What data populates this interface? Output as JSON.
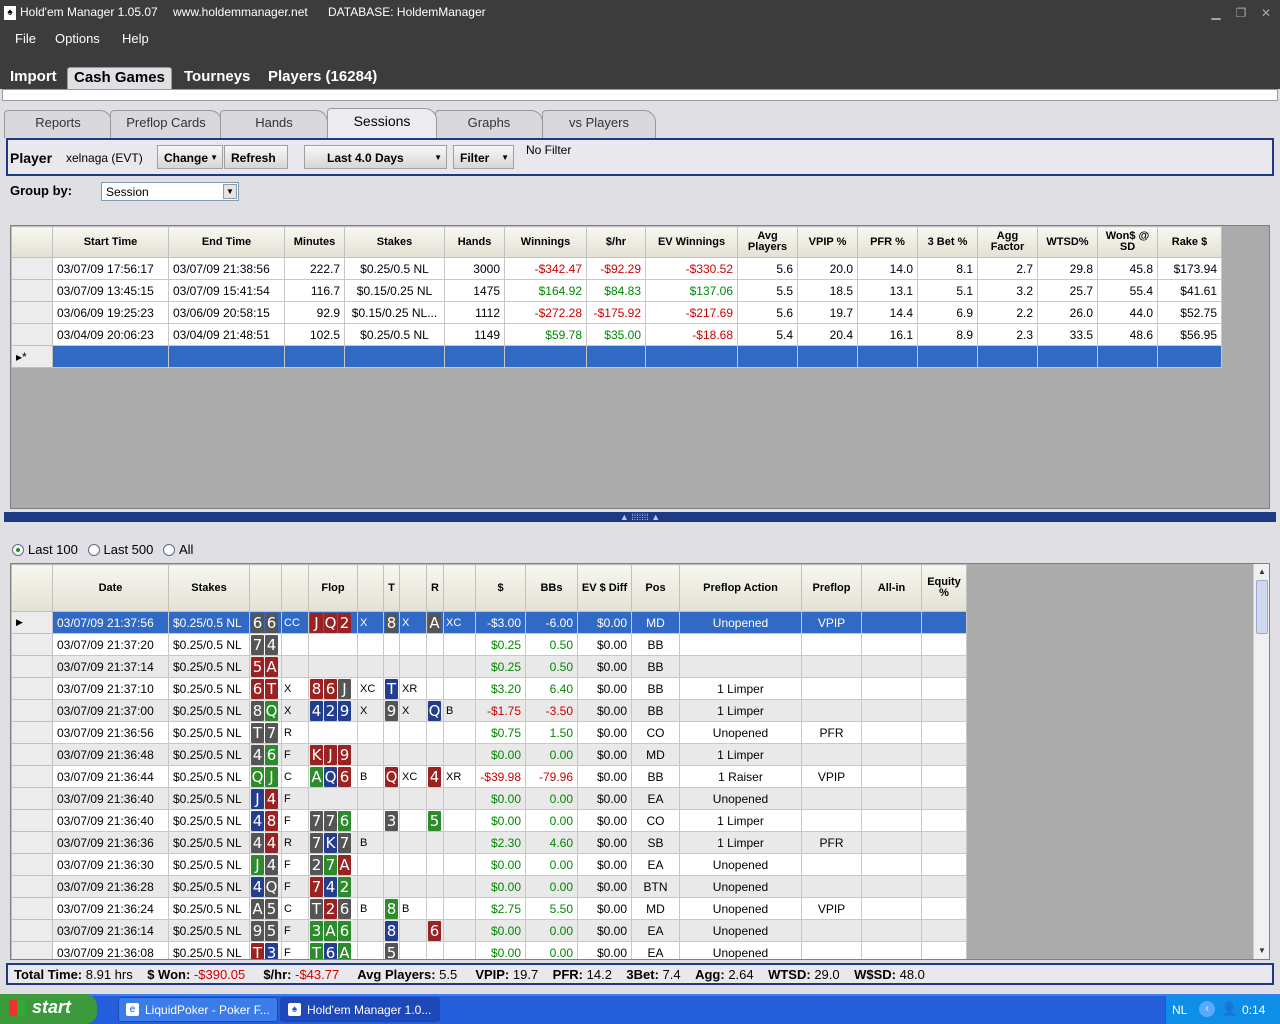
{
  "window": {
    "app_title": "Hold'em Manager 1.05.07",
    "site": "www.holdemmanager.net",
    "database": "DATABASE: HoldemManager"
  },
  "menu": {
    "file": "File",
    "options": "Options",
    "help": "Help"
  },
  "main_tabs": [
    "Import",
    "Cash Games",
    "Tourneys",
    "Players (16284)"
  ],
  "sub_tabs": [
    "Reports",
    "Preflop Cards",
    "Hands",
    "Sessions",
    "Graphs",
    "vs Players"
  ],
  "player_bar": {
    "player_label": "Player",
    "player_name": "xelnaga (EVT)",
    "change": "Change",
    "refresh": "Refresh",
    "date_range": "Last 4.0 Days",
    "filter": "Filter",
    "filter_status": "No Filter"
  },
  "group_by": {
    "label": "Group by:",
    "value": "Session"
  },
  "sessions": {
    "headers": [
      "Start Time",
      "End Time",
      "Minutes",
      "Stakes",
      "Hands",
      "Winnings",
      "$/hr",
      "EV Winnings",
      "Avg Players",
      "VPIP %",
      "PFR %",
      "3 Bet %",
      "Agg Factor",
      "WTSD%",
      "Won$ @ SD",
      "Rake $"
    ],
    "rows": [
      [
        "03/07/09 17:56:17",
        "03/07/09 21:38:56",
        "222.7",
        "$0.25/0.5 NL",
        "3000",
        "-$342.47",
        "-$92.29",
        "-$330.52",
        "5.6",
        "20.0",
        "14.0",
        "8.1",
        "2.7",
        "29.8",
        "45.8",
        "$173.94"
      ],
      [
        "03/07/09 13:45:15",
        "03/07/09 15:41:54",
        "116.7",
        "$0.15/0.25 NL",
        "1475",
        "$164.92",
        "$84.83",
        "$137.06",
        "5.5",
        "18.5",
        "13.1",
        "5.1",
        "3.2",
        "25.7",
        "55.4",
        "$41.61"
      ],
      [
        "03/06/09 19:25:23",
        "03/06/09 20:58:15",
        "92.9",
        "$0.15/0.25 NL...",
        "1112",
        "-$272.28",
        "-$175.92",
        "-$217.69",
        "5.6",
        "19.7",
        "14.4",
        "6.9",
        "2.2",
        "26.0",
        "44.0",
        "$52.75"
      ],
      [
        "03/04/09 20:06:23",
        "03/04/09 21:48:51",
        "102.5",
        "$0.25/0.5 NL",
        "1149",
        "$59.78",
        "$35.00",
        "-$18.68",
        "5.4",
        "20.4",
        "16.1",
        "8.9",
        "2.3",
        "33.5",
        "48.6",
        "$56.95"
      ]
    ],
    "new_row_marker": "▸*"
  },
  "hands_filter": {
    "last100": "Last 100",
    "last500": "Last 500",
    "all": "All",
    "selected": "last100"
  },
  "hands": {
    "headers": [
      "Date",
      "Stakes",
      "",
      "",
      "Flop",
      "",
      "T",
      "",
      "R",
      "",
      "$",
      "BBs",
      "EV $ Diff",
      "Pos",
      "Preflop Action",
      "Preflop",
      "All-in",
      "Equity %"
    ],
    "rows": [
      {
        "date": "03/07/09 21:37:56",
        "stakes": "$0.25/0.5 NL",
        "hole": [
          "6s",
          "6s"
        ],
        "pa": "CC",
        "flop": [
          "Jh",
          "Qh",
          "2h"
        ],
        "fa": "X",
        "turn": [
          "8s"
        ],
        "ta": "X",
        "river": [
          "As"
        ],
        "ra": "XC",
        "won": "-$3.00",
        "bbs": "-6.00",
        "ev": "$0.00",
        "pos": "MD",
        "action": "Unopened",
        "preflop": "VPIP"
      },
      {
        "date": "03/07/09 21:37:20",
        "stakes": "$0.25/0.5 NL",
        "hole": [
          "7s",
          "4s"
        ],
        "pa": "",
        "flop": [],
        "fa": "",
        "turn": [],
        "ta": "",
        "river": [],
        "ra": "",
        "won": "$0.25",
        "bbs": "0.50",
        "ev": "$0.00",
        "pos": "BB",
        "action": "",
        "preflop": ""
      },
      {
        "date": "03/07/09 21:37:14",
        "stakes": "$0.25/0.5 NL",
        "hole": [
          "5h",
          "Ah"
        ],
        "pa": "",
        "flop": [],
        "fa": "",
        "turn": [],
        "ta": "",
        "river": [],
        "ra": "",
        "won": "$0.25",
        "bbs": "0.50",
        "ev": "$0.00",
        "pos": "BB",
        "action": "",
        "preflop": ""
      },
      {
        "date": "03/07/09 21:37:10",
        "stakes": "$0.25/0.5 NL",
        "hole": [
          "6h",
          "Th"
        ],
        "pa": "X",
        "flop": [
          "8h",
          "6h",
          "Js"
        ],
        "fa": "XC",
        "turn": [
          "Td"
        ],
        "ta": "XR",
        "river": [],
        "ra": "",
        "won": "$3.20",
        "bbs": "6.40",
        "ev": "$0.00",
        "pos": "BB",
        "action": "1 Limper",
        "preflop": ""
      },
      {
        "date": "03/07/09 21:37:00",
        "stakes": "$0.25/0.5 NL",
        "hole": [
          "8s",
          "Qk"
        ],
        "pa": "X",
        "flop": [
          "4d",
          "2d",
          "9d"
        ],
        "fa": "X",
        "turn": [
          "9s"
        ],
        "ta": "X",
        "river": [
          "Qd"
        ],
        "ra": "B",
        "won": "-$1.75",
        "bbs": "-3.50",
        "ev": "$0.00",
        "pos": "BB",
        "action": "1 Limper",
        "preflop": ""
      },
      {
        "date": "03/07/09 21:36:56",
        "stakes": "$0.25/0.5 NL",
        "hole": [
          "Ts",
          "7s"
        ],
        "pa": "R",
        "flop": [],
        "fa": "",
        "turn": [],
        "ta": "",
        "river": [],
        "ra": "",
        "won": "$0.75",
        "bbs": "1.50",
        "ev": "$0.00",
        "pos": "CO",
        "action": "Unopened",
        "preflop": "PFR"
      },
      {
        "date": "03/07/09 21:36:48",
        "stakes": "$0.25/0.5 NL",
        "hole": [
          "4s",
          "6k"
        ],
        "pa": "F",
        "flop": [
          "Kh",
          "Jh",
          "9h"
        ],
        "fa": "",
        "turn": [],
        "ta": "",
        "river": [],
        "ra": "",
        "won": "$0.00",
        "bbs": "0.00",
        "ev": "$0.00",
        "pos": "MD",
        "action": "1 Limper",
        "preflop": ""
      },
      {
        "date": "03/07/09 21:36:44",
        "stakes": "$0.25/0.5 NL",
        "hole": [
          "Qk",
          "Jk"
        ],
        "pa": "C",
        "flop": [
          "Ak",
          "Qd",
          "6h"
        ],
        "fa": "B",
        "turn": [
          "Qh"
        ],
        "ta": "XC",
        "river": [
          "4h"
        ],
        "ra": "XR",
        "won": "-$39.98",
        "bbs": "-79.96",
        "ev": "$0.00",
        "pos": "BB",
        "action": "1 Raiser",
        "preflop": "VPIP"
      },
      {
        "date": "03/07/09 21:36:40",
        "stakes": "$0.25/0.5 NL",
        "hole": [
          "Jd",
          "4h"
        ],
        "pa": "F",
        "flop": [],
        "fa": "",
        "turn": [],
        "ta": "",
        "river": [],
        "ra": "",
        "won": "$0.00",
        "bbs": "0.00",
        "ev": "$0.00",
        "pos": "EA",
        "action": "Unopened",
        "preflop": ""
      },
      {
        "date": "03/07/09 21:36:40",
        "stakes": "$0.25/0.5 NL",
        "hole": [
          "4d",
          "8h"
        ],
        "pa": "F",
        "flop": [
          "7s",
          "7s",
          "6k"
        ],
        "fa": "",
        "turn": [
          "3s"
        ],
        "ta": "",
        "river": [
          "5k"
        ],
        "ra": "",
        "won": "$0.00",
        "bbs": "0.00",
        "ev": "$0.00",
        "pos": "CO",
        "action": "1 Limper",
        "preflop": ""
      },
      {
        "date": "03/07/09 21:36:36",
        "stakes": "$0.25/0.5 NL",
        "hole": [
          "4s",
          "4h"
        ],
        "pa": "R",
        "flop": [
          "7s",
          "Kd",
          "7s"
        ],
        "fa": "B",
        "turn": [],
        "ta": "",
        "river": [],
        "ra": "",
        "won": "$2.30",
        "bbs": "4.60",
        "ev": "$0.00",
        "pos": "SB",
        "action": "1 Limper",
        "preflop": "PFR"
      },
      {
        "date": "03/07/09 21:36:30",
        "stakes": "$0.25/0.5 NL",
        "hole": [
          "Jk",
          "4s"
        ],
        "pa": "F",
        "flop": [
          "2s",
          "7k",
          "Ah"
        ],
        "fa": "",
        "turn": [],
        "ta": "",
        "river": [],
        "ra": "",
        "won": "$0.00",
        "bbs": "0.00",
        "ev": "$0.00",
        "pos": "EA",
        "action": "Unopened",
        "preflop": ""
      },
      {
        "date": "03/07/09 21:36:28",
        "stakes": "$0.25/0.5 NL",
        "hole": [
          "4d",
          "Qs"
        ],
        "pa": "F",
        "flop": [
          "7h",
          "4d",
          "2k"
        ],
        "fa": "",
        "turn": [],
        "ta": "",
        "river": [],
        "ra": "",
        "won": "$0.00",
        "bbs": "0.00",
        "ev": "$0.00",
        "pos": "BTN",
        "action": "Unopened",
        "preflop": ""
      },
      {
        "date": "03/07/09 21:36:24",
        "stakes": "$0.25/0.5 NL",
        "hole": [
          "As",
          "5s"
        ],
        "pa": "C",
        "flop": [
          "Ts",
          "2h",
          "6s"
        ],
        "fa": "B",
        "turn": [
          "8k"
        ],
        "ta": "B",
        "river": [],
        "ra": "",
        "won": "$2.75",
        "bbs": "5.50",
        "ev": "$0.00",
        "pos": "MD",
        "action": "Unopened",
        "preflop": "VPIP"
      },
      {
        "date": "03/07/09 21:36:14",
        "stakes": "$0.25/0.5 NL",
        "hole": [
          "9s",
          "5s"
        ],
        "pa": "F",
        "flop": [
          "3k",
          "Ak",
          "6k"
        ],
        "fa": "",
        "turn": [
          "8d"
        ],
        "ta": "",
        "river": [
          "6h"
        ],
        "ra": "",
        "won": "$0.00",
        "bbs": "0.00",
        "ev": "$0.00",
        "pos": "EA",
        "action": "Unopened",
        "preflop": ""
      },
      {
        "date": "03/07/09 21:36:08",
        "stakes": "$0.25/0.5 NL",
        "hole": [
          "Th",
          "3d"
        ],
        "pa": "F",
        "flop": [
          "Tk",
          "6d",
          "Ak"
        ],
        "fa": "",
        "turn": [
          "5s"
        ],
        "ta": "",
        "river": [],
        "ra": "",
        "won": "$0.00",
        "bbs": "0.00",
        "ev": "$0.00",
        "pos": "EA",
        "action": "Unopened",
        "preflop": ""
      }
    ]
  },
  "totals": {
    "total_time_label": "Total Time:",
    "total_time": "8.91 hrs",
    "won_label": "$ Won:",
    "won": "-$390.05",
    "hr_label": "$/hr:",
    "hr": "-$43.77",
    "avg_label": "Avg Players:",
    "avg": "5.5",
    "vpip_label": "VPIP:",
    "vpip": "19.7",
    "pfr_label": "PFR:",
    "pfr": "14.2",
    "threebet_label": "3Bet:",
    "threebet": "7.4",
    "agg_label": "Agg:",
    "agg": "2.64",
    "wtsd_label": "WTSD:",
    "wtsd": "29.0",
    "wsd_label": "W$SD:",
    "wsd": "48.0"
  },
  "taskbar": {
    "start": "start",
    "task1": "LiquidPoker - Poker F...",
    "task2": "Hold'em Manager 1.0...",
    "lang": "NL",
    "clock": "0:14"
  },
  "colors": {
    "title_bg": "#3c3c3c",
    "accent": "#1d3a84",
    "selection": "#316ac5",
    "negative": "#d00000",
    "positive": "#008800",
    "spade": "#555555",
    "heart": "#9a2222",
    "diamond": "#233e8e",
    "club": "#2d8a2d"
  }
}
